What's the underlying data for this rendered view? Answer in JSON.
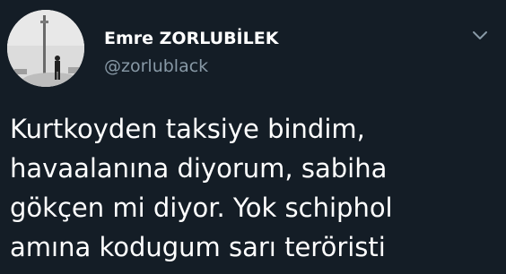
{
  "author": {
    "display_name": "Emre ZORLUBİLEK",
    "username": "@zorlublack"
  },
  "tweet": {
    "text": "Kurtkoyden taksiye bindim,\nhavaalanına diyorum, sabiha\ngökçen mi diyor. Yok schiphol\namına kodugum sarı teröristi"
  },
  "colors": {
    "background": "#141d26",
    "name": "#ffffff",
    "username": "#8899a6",
    "text": "#ffffff"
  },
  "icons": {
    "menu": "chevron-down-icon",
    "avatar": "profile-photo"
  }
}
